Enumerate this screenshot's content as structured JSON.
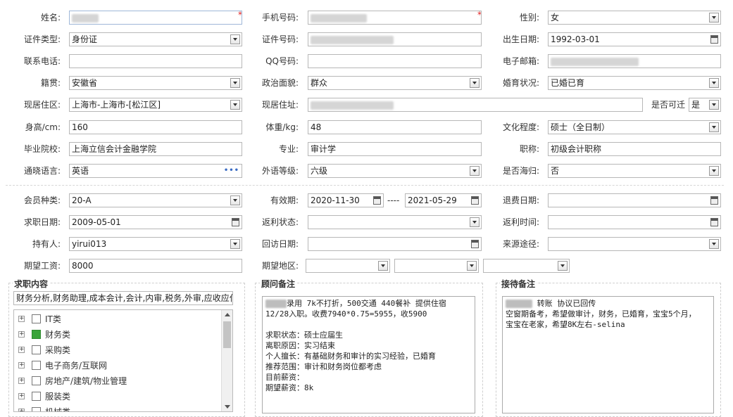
{
  "personal": {
    "name_label": "姓名:",
    "phone_label": "手机号码:",
    "gender_label": "性别:",
    "gender_value": "女",
    "id_type_label": "证件类型:",
    "id_type_value": "身份证",
    "id_no_label": "证件号码:",
    "birth_label": "出生日期:",
    "birth_value": "1992-03-01",
    "tel_label": "联系电话:",
    "qq_label": "QQ号码:",
    "email_label": "电子邮箱:",
    "native_label": "籍贯:",
    "native_value": "安徽省",
    "political_label": "政治面貌:",
    "political_value": "群众",
    "marital_label": "婚育状况:",
    "marital_value": "已婚已育",
    "residence_label": "现居住区:",
    "residence_value": "上海市-上海市-[松江区]",
    "address_label": "现居住址:",
    "relocate_label": "是否可迁",
    "relocate_value": "是",
    "height_label": "身高/cm:",
    "height_value": "160",
    "weight_label": "体重/kg:",
    "weight_value": "48",
    "edu_label": "文化程度:",
    "edu_value": "硕士（全日制）",
    "school_label": "毕业院校:",
    "school_value": "上海立信会计金融学院",
    "major_label": "专业:",
    "major_value": "审计学",
    "title_label": "职称:",
    "title_value": "初级会计职称",
    "lang_label": "通晓语言:",
    "lang_value": "英语",
    "lang_level_label": "外语等级:",
    "lang_level_value": "六级",
    "overseas_label": "是否海归:",
    "overseas_value": "否"
  },
  "member": {
    "type_label": "会员种类:",
    "type_value": "20-A",
    "valid_label": "有效期:",
    "valid_from": "2020-11-30",
    "valid_sep": "----",
    "valid_to": "2021-05-29",
    "refund_date_label": "退费日期:",
    "seek_date_label": "求职日期:",
    "seek_date_value": "2009-05-01",
    "rebate_status_label": "返利状态:",
    "rebate_time_label": "返利时间:",
    "holder_label": "持有人:",
    "holder_value": "yirui013",
    "revisit_label": "回访日期:",
    "source_label": "来源途径:",
    "salary_label": "期望工资:",
    "salary_value": "8000",
    "region_label": "期望地区:"
  },
  "job_content": {
    "legend": "求职内容",
    "summary": "财务分析,财务助理,成本会计,会计,内审,税务,外审,应收应付",
    "items": [
      {
        "label": "IT类",
        "checked": false
      },
      {
        "label": "财务类",
        "checked": true
      },
      {
        "label": "采购类",
        "checked": false
      },
      {
        "label": "电子商务/互联网",
        "checked": false
      },
      {
        "label": "房地产/建筑/物业管理",
        "checked": false
      },
      {
        "label": "服装类",
        "checked": false
      },
      {
        "label": "机械类",
        "checked": false
      }
    ]
  },
  "consultant_notes": {
    "legend": "顾问备注",
    "line1_suffix": "录用 7k不打折，500交通 440餐补 提供住宿",
    "body": "12/28入职。收费7940*0.75=5955，收5900\n\n求职状态：硕士应届生\n离职原因：实习结束\n个人擅长：有基础财务和审计的实习经验，已婚育\n推荐范围：审计和财务岗位都考虑\n目前薪资：\n期望薪资：8k"
  },
  "reception_notes": {
    "legend": "接待备注",
    "line1_suffix": " 转账 协议已回传",
    "body": "空窗期备考，希望做审计，财务，已婚育，宝宝5个月，\n宝宝在老家，希望8K左右-selina"
  }
}
